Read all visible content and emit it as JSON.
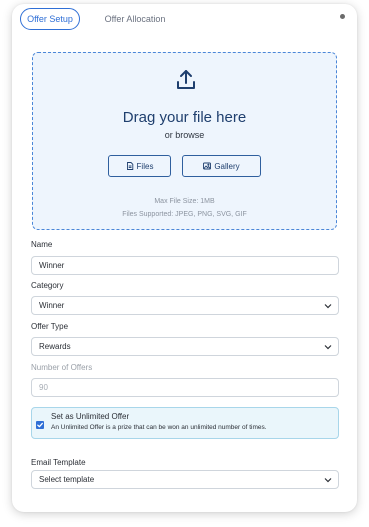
{
  "tabs": {
    "offer_setup": "Offer Setup",
    "offer_allocation": "Offer Allocation"
  },
  "upload": {
    "title": "Drag your file here",
    "subtitle": "or browse",
    "files_button": "Files",
    "gallery_button": "Gallery",
    "max_size": "Max File Size: 1MB",
    "supported": "Files Supported: JPEG, PNG, SVG, GIF",
    "icons": {
      "upload": "upload-icon",
      "files": "file-icon",
      "gallery": "image-icon"
    }
  },
  "form": {
    "name": {
      "label": "Name",
      "value": "Winner"
    },
    "category": {
      "label": "Category",
      "value": "Winner"
    },
    "offer_type": {
      "label": "Offer Type",
      "value": "Rewards"
    },
    "number_of_offers": {
      "label": "Number of Offers",
      "value": "90"
    },
    "unlimited": {
      "label": "Set as Unlimited Offer",
      "description": "An Unlimited Offer is a prize that can be won an unlimited number of times.",
      "checked": true
    },
    "email_template": {
      "label": "Email Template",
      "value": "Select template"
    }
  },
  "colors": {
    "accent": "#2f6fd6",
    "upload_bg": "#eef5fd",
    "unlimited_bg": "#eaf6fb"
  }
}
